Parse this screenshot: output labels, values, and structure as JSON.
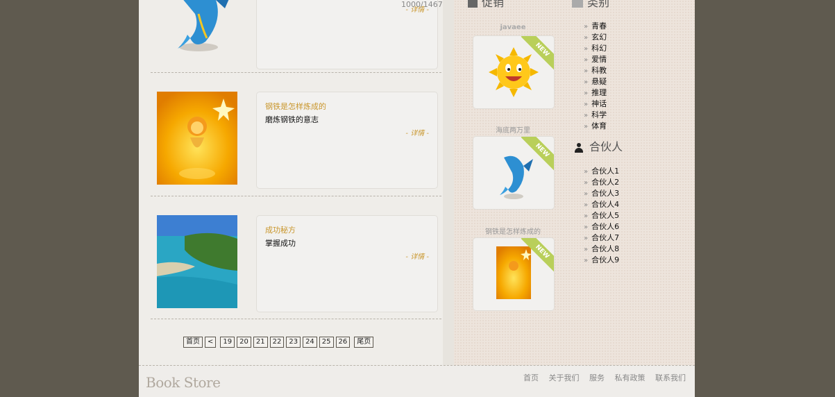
{
  "books": [
    {
      "title": "",
      "desc": "",
      "more": "- 详情 -",
      "counter": "1000/1467"
    },
    {
      "title": "钢铁是怎样炼成的",
      "desc": "磨炼钢铁的意志",
      "more": "- 详情 -"
    },
    {
      "title": "成功秘方",
      "desc": "掌握成功",
      "more": "- 详情 -"
    }
  ],
  "pagination": [
    "首页",
    "<",
    "19",
    "20",
    "21",
    "22",
    "23",
    "24",
    "25",
    "26",
    "尾页"
  ],
  "sidebar": {
    "section1_title": "促销",
    "section2_title": "类别",
    "partners_title": "合伙人",
    "featured": [
      {
        "caption": "javaee",
        "ribbon": "NEW"
      },
      {
        "caption": "海底两万里",
        "ribbon": "NEW"
      },
      {
        "caption": "钢铁是怎样炼成的",
        "ribbon": "NEW"
      }
    ],
    "categories": [
      "青春",
      "玄幻",
      "科幻",
      "爱情",
      "科教",
      "悬疑",
      "推理",
      "神话",
      "科学",
      "体育"
    ],
    "partners": [
      "合伙人1",
      "合伙人2",
      "合伙人3",
      "合伙人4",
      "合伙人5",
      "合伙人6",
      "合伙人7",
      "合伙人8",
      "合伙人9"
    ]
  },
  "footer": {
    "logo": "Book Store",
    "nav": [
      "首页",
      "关于我们",
      "服务",
      "私有政策",
      "联系我们"
    ]
  }
}
